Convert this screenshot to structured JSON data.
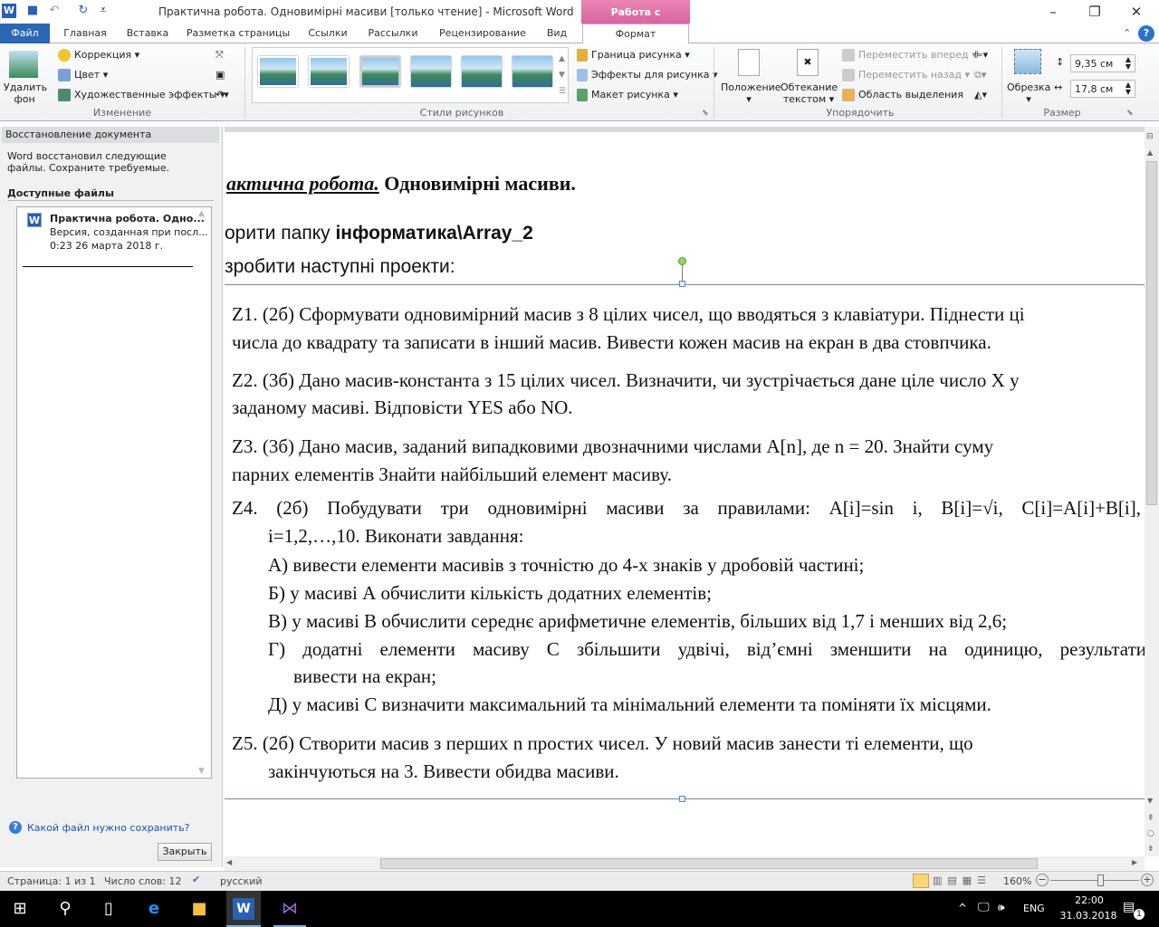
{
  "window": {
    "title": "Практична робота. Одновимірні масиви [только чтение]  -  Microsoft Word",
    "context_tab": "Работа с рисунками"
  },
  "tabs": [
    "Файл",
    "Главная",
    "Вставка",
    "Разметка страницы",
    "Ссылки",
    "Рассылки",
    "Рецензирование",
    "Вид",
    "Формат"
  ],
  "ribbon": {
    "remove_bg": [
      "Удалить",
      "фон"
    ],
    "correction": "Коррекция",
    "color": "Цвет",
    "art_effects": "Художественные эффекты",
    "group_change": "Изменение",
    "group_styles": "Стили рисунков",
    "border": "Граница рисунка",
    "effects": "Эффекты для рисунка",
    "layout": "Макет рисунка",
    "position": "Положение",
    "wrap": [
      "Обтекание",
      "текстом"
    ],
    "bring_forward": "Переместить вперед",
    "send_backward": "Переместить назад",
    "selection_pane": "Область выделения",
    "group_arrange": "Упорядочить",
    "crop": "Обрезка",
    "height": "9,35 см",
    "width": "17,8 см",
    "group_size": "Размер"
  },
  "recovery": {
    "title": "Восстановление документа",
    "message": "Word восстановил следующие файлы. Сохраните требуемые.",
    "available": "Доступные файлы",
    "file": {
      "name": "Практична робота. Одно...",
      "desc": "Версия, созданная при посл...",
      "time": "0:23 26 марта 2018 г."
    },
    "help": "Какой файл нужно сохранить?",
    "close": "Закрыть"
  },
  "document": {
    "heading_italic": "актична робота.",
    "heading_bold": " Одновимірні масиви.",
    "line2a": "орити папку ",
    "line2b": "інформатика\\Array_2",
    "line3": "зробити наступні проекти:",
    "lines": [
      "Z1. (2б) Сформувати одновимірний масив з 8 цілих чисел, що вводяться з клавіатури. Піднести ці",
      "числа до квадрату та записати в інший масив. Вивести кожен масив на екран в два стовпчика.",
      "Z2. (3б) Дано масив-константа з 15 цілих чисел. Визначити, чи зустрічається дане ціле число X у",
      "заданому масиві. Відповісти YES або NO.",
      "Z3. (3б) Дано масив, заданий випадковими двозначними числами A[n], де n = 20. Знайти суму",
      "парних елементів Знайти найбільший елемент масиву.",
      "Z4. (2б) Побудувати три одновимірні масиви за правилами: A[i]=sin i, B[i]=√i, C[i]=A[i]+B[i],",
      "i=1,2,…,10. Виконати завдання:",
      "А) вивести елементи масивів з точністю до 4-х знаків у дробовій частині;",
      "Б) у масиві А обчислити кількість додатних елементів;",
      "В) у масиві В обчислити середнє арифметичне елементів, більших від 1,7 і менших від 2,6;",
      "Г) додатні елементи масиву С збільшити удвічі, від’ємні зменшити на одиницю, результати",
      "вивести на екран;",
      "Д) у масиві С визначити максимальний та мінімальний елементи та поміняти їх місцями.",
      "Z5. (2б) Створити масив з перших n простих чисел. У новий масив занести ті елементи, що",
      "закінчуються на 3. Вивести обидва масиви."
    ]
  },
  "status": {
    "page": "Страница: 1 из 1",
    "words": "Число слов: 12",
    "lang": "русский",
    "zoom": "160%",
    "zoom_value": 160
  },
  "taskbar": {
    "lang": "ENG",
    "time": "22:00",
    "date": "31.03.2018",
    "notif": "1"
  }
}
